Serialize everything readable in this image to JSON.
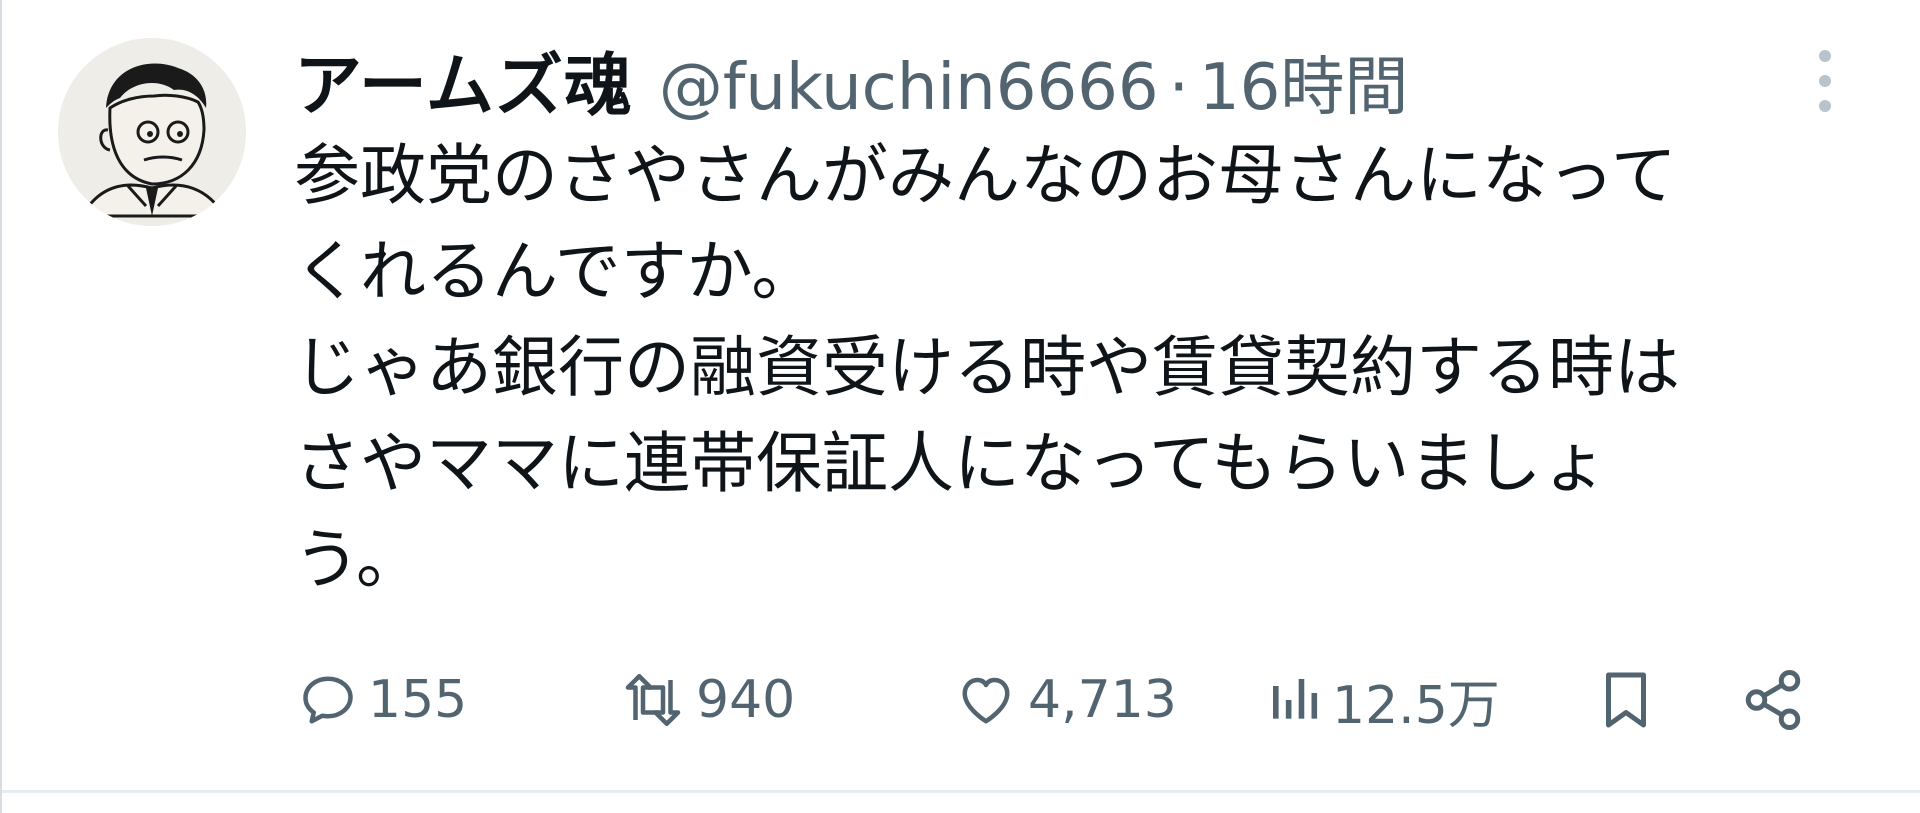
{
  "user": {
    "display_name": "アームズ魂",
    "handle": "@fukuchin6666",
    "separator": "·",
    "time": "16時間",
    "avatar_icon": "caricature-avatar-icon"
  },
  "tweet": {
    "lines": [
      "参政党のさやさんがみんなのお母さんになって",
      "くれるんですか。",
      "じゃあ銀行の融資受ける時や賃貸契約する時は",
      "さやママに連帯保証人になってもらいましょ",
      "う。"
    ]
  },
  "actions": {
    "reply": {
      "icon": "reply-icon",
      "count": "155"
    },
    "retweet": {
      "icon": "retweet-icon",
      "count": "940"
    },
    "like": {
      "icon": "heart-icon",
      "count": "4,713"
    },
    "views": {
      "icon": "views-chart-icon",
      "count": "12.5万"
    },
    "bookmark": {
      "icon": "bookmark-icon"
    },
    "share": {
      "icon": "share-icon"
    }
  },
  "colors": {
    "text_primary": "#0f1419",
    "text_secondary": "#536471",
    "more_dots": "#b8c3cc",
    "divider": "#e6ecf0"
  }
}
